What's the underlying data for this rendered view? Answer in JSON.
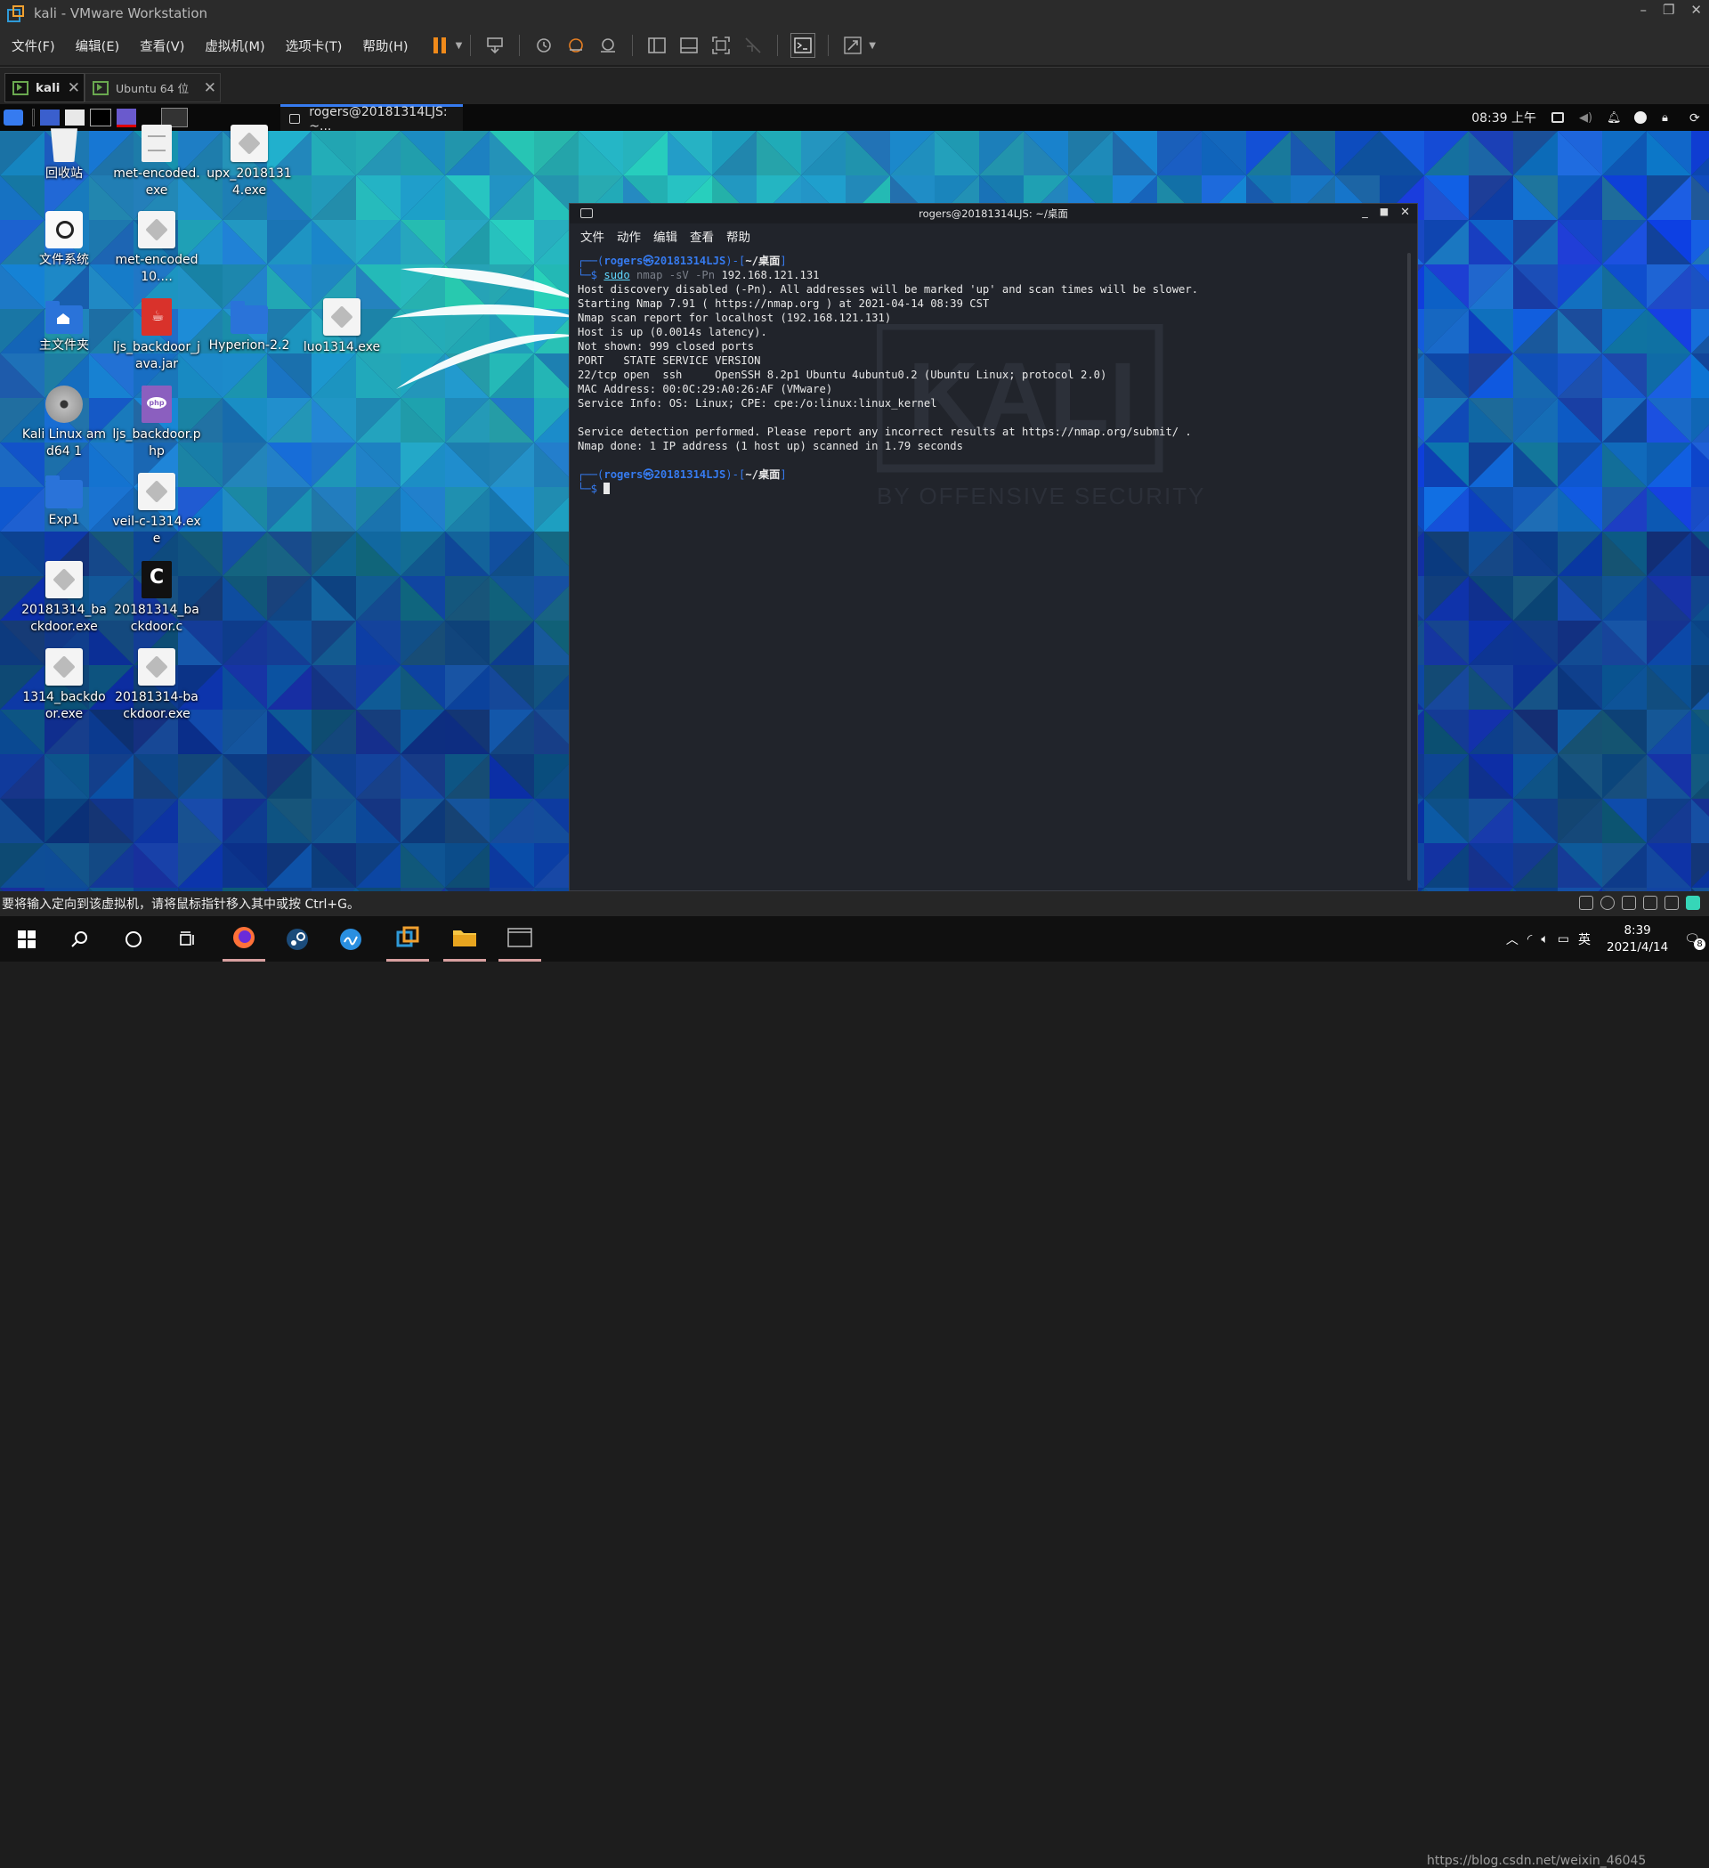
{
  "window": {
    "title": "kali - VMware Workstation",
    "controls": [
      "–",
      "❐",
      "✕"
    ]
  },
  "menu": [
    "文件(F)",
    "编辑(E)",
    "查看(V)",
    "虚拟机(M)",
    "选项卡(T)",
    "帮助(H)"
  ],
  "vm_tabs": [
    {
      "label": "kali",
      "close": "✕"
    },
    {
      "label": "Ubuntu 64 位",
      "close": "✕"
    }
  ],
  "guest_panel": {
    "task_button": "rogers@20181314LJS: ~...",
    "clock": "08:39 上午"
  },
  "desktop_icons": [
    {
      "label": "回收站",
      "icon": "trash-icon"
    },
    {
      "label": "met-encoded.exe",
      "icon": "document-icon"
    },
    {
      "label": "upx_20181314.exe",
      "icon": "executable-icon"
    },
    {
      "label": "文件系统",
      "icon": "filesystem-icon"
    },
    {
      "label": "met-encoded10....",
      "icon": "executable-icon"
    },
    {
      "label": "主文件夹",
      "icon": "home-folder-icon"
    },
    {
      "label": "ljs_backdoor_java.jar",
      "icon": "java-icon"
    },
    {
      "label": "Hyperion-2.2",
      "icon": "folder-icon"
    },
    {
      "label": "luo1314.exe",
      "icon": "executable-icon"
    },
    {
      "label": "Kali Linux amd64 1",
      "icon": "disc-icon"
    },
    {
      "label": "ljs_backdoor.php",
      "icon": "php-icon"
    },
    {
      "label": "Exp1",
      "icon": "folder-icon"
    },
    {
      "label": "veil-c-1314.exe",
      "icon": "executable-icon"
    },
    {
      "label": "20181314_backdoor.exe",
      "icon": "executable-icon"
    },
    {
      "label": "20181314_backdoor.c",
      "icon": "c-source-icon"
    },
    {
      "label": "1314_backdoor.exe",
      "icon": "executable-icon"
    },
    {
      "label": "20181314-backdoor.exe",
      "icon": "executable-icon"
    }
  ],
  "terminal": {
    "title": "rogers@20181314LJS: ~/桌面",
    "menu": [
      "文件",
      "动作",
      "编辑",
      "查看",
      "帮助"
    ],
    "prompt": {
      "user": "rogers㉿20181314LJS",
      "dir": "~/桌面"
    },
    "command": {
      "sudo": "sudo",
      "nmap": " nmap",
      "opts": " -sV -Pn",
      "target": " 192.168.121.131"
    },
    "output": [
      "Host discovery disabled (-Pn). All addresses will be marked 'up' and scan times will be slower.",
      "Starting Nmap 7.91 ( https://nmap.org ) at 2021-04-14 08:39 CST",
      "Nmap scan report for localhost (192.168.121.131)",
      "Host is up (0.0014s latency).",
      "Not shown: 999 closed ports",
      "PORT   STATE SERVICE VERSION",
      "22/tcp open  ssh     OpenSSH 8.2p1 Ubuntu 4ubuntu0.2 (Ubuntu Linux; protocol 2.0)",
      "MAC Address: 00:0C:29:A0:26:AF (VMware)",
      "Service Info: OS: Linux; CPE: cpe:/o:linux:linux_kernel",
      "",
      "Service detection performed. Please report any incorrect results at https://nmap.org/submit/ .",
      "Nmap done: 1 IP address (1 host up) scanned in 1.79 seconds"
    ]
  },
  "wallpaper": {
    "brand": "KALI",
    "tagline": "BY OFFENSIVE SECURITY"
  },
  "status_bar": {
    "hint": "要将输入定向到该虚拟机，请将鼠标指针移入其中或按 Ctrl+G。"
  },
  "win_taskbar": {
    "ime": "英",
    "time": "8:39",
    "date": "2021/4/14",
    "notify_count": "8"
  },
  "watermark": "https://blog.csdn.net/weixin_46045",
  "colors": {
    "kali_blue": "#367bf0",
    "terminal_bg": "#21242b",
    "vmware_chrome": "#2b2b2b",
    "pause_orange": "#f08a1a"
  }
}
